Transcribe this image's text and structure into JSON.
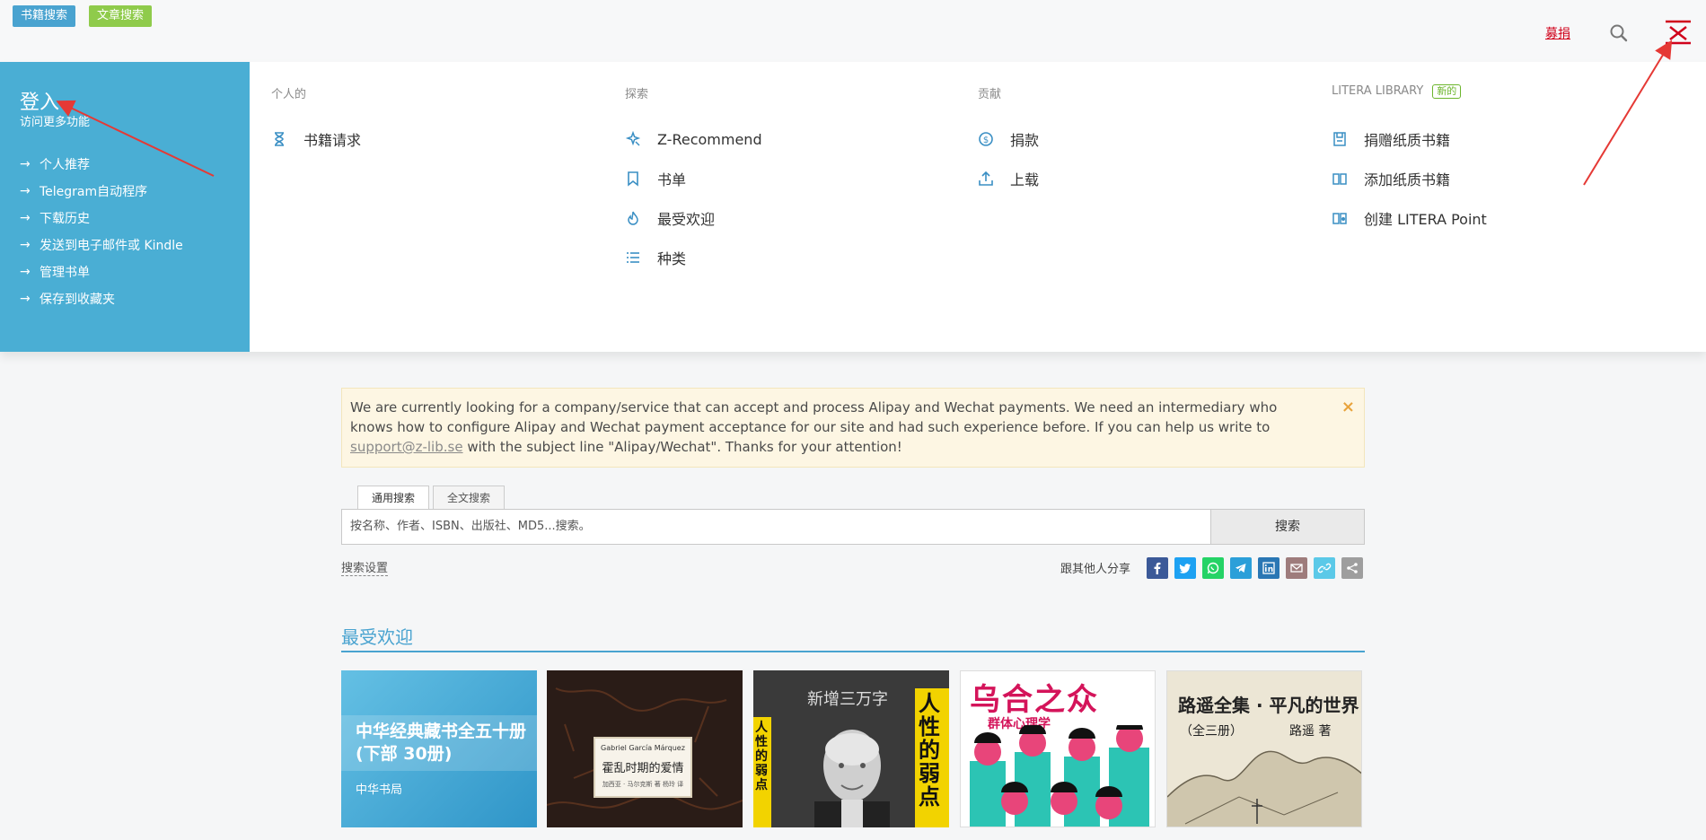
{
  "topbar": {
    "chip_books": "书籍搜索",
    "chip_articles": "文章搜索",
    "donate": "募捐",
    "search_icon": "search-icon",
    "menu_icon": "menu-close-icon",
    "colors": {
      "chip_books": "#49a3d0",
      "chip_articles": "#8fcb4b",
      "donate": "#d0021b"
    }
  },
  "login": {
    "title": "登入",
    "subtitle": "访问更多功能",
    "items": [
      {
        "label": "个人推荐"
      },
      {
        "label": "Telegram自动程序"
      },
      {
        "label": "下载历史"
      },
      {
        "label": "发送到电子邮件或 Kindle"
      },
      {
        "label": "管理书单"
      },
      {
        "label": "保存到收藏夹"
      }
    ],
    "color": "#4aaed4"
  },
  "menu": {
    "personal": {
      "heading": "个人的",
      "items": [
        {
          "label": "书籍请求",
          "icon": "hourglass-icon"
        }
      ]
    },
    "explore": {
      "heading": "探索",
      "items": [
        {
          "label": "Z-Recommend",
          "icon": "sparkle-icon"
        },
        {
          "label": "书单",
          "icon": "bookmark-icon"
        },
        {
          "label": "最受欢迎",
          "icon": "flame-icon"
        },
        {
          "label": "种类",
          "icon": "list-icon"
        }
      ]
    },
    "contribute": {
      "heading": "贡献",
      "items": [
        {
          "label": "捐款",
          "icon": "dollar-coin-icon"
        },
        {
          "label": "上载",
          "icon": "upload-icon"
        }
      ]
    },
    "litera": {
      "heading": "LITERA LIBRARY",
      "badge": "新的",
      "items": [
        {
          "label": "捐赠纸质书籍",
          "icon": "save-book-icon"
        },
        {
          "label": "添加纸质书籍",
          "icon": "open-book-icon"
        },
        {
          "label": "创建 LITERA Point",
          "icon": "map-book-icon"
        }
      ]
    }
  },
  "notice": {
    "text_before": "We are currently looking for a company/service that can accept and process Alipay and Wechat payments. We need an intermediary who knows how to configure Alipay and Wechat payment acceptance for our site and had such experience before. If you can help us write to ",
    "email": "support@z-lib.se",
    "text_after": " with the subject line \"Alipay/Wechat\". Thanks for your attention!",
    "close": "×"
  },
  "search": {
    "tabs": [
      "通用搜索",
      "全文搜索"
    ],
    "placeholder": "按名称、作者、ISBN、出版社、MD5...搜索。",
    "submit": "搜索",
    "settings": "搜索设置",
    "share_label": "跟其他人分享",
    "share_icons": [
      {
        "name": "facebook-icon",
        "color": "#3b5998"
      },
      {
        "name": "twitter-icon",
        "color": "#1da1f2"
      },
      {
        "name": "whatsapp-icon",
        "color": "#25d366"
      },
      {
        "name": "telegram-icon",
        "color": "#2b9fd9"
      },
      {
        "name": "linkedin-icon",
        "color": "#2a77b4"
      },
      {
        "name": "email-icon",
        "color": "#9e7c7c"
      },
      {
        "name": "link-icon",
        "color": "#5bc9e8"
      },
      {
        "name": "share-icon",
        "color": "#9e9e9e"
      }
    ]
  },
  "popular": {
    "title": "最受欢迎",
    "books": [
      {
        "title": "中华经典藏书全五十册(下部 30册)",
        "publisher": "中华书局"
      },
      {
        "author_latin": "Gabriel García Márquez",
        "title": "霍乱时期的爱情",
        "sub": "加西亚 · 马尔克斯 著  杨玲 译"
      },
      {
        "top": "新增三万字",
        "left": "人性的弱点",
        "right": "人性的弱点"
      },
      {
        "title": "乌合之众",
        "sub": "群体心理学"
      },
      {
        "title": "路遥全集 · 平凡的世界",
        "vol": "（全三册）",
        "author": "路遥 著"
      }
    ]
  }
}
